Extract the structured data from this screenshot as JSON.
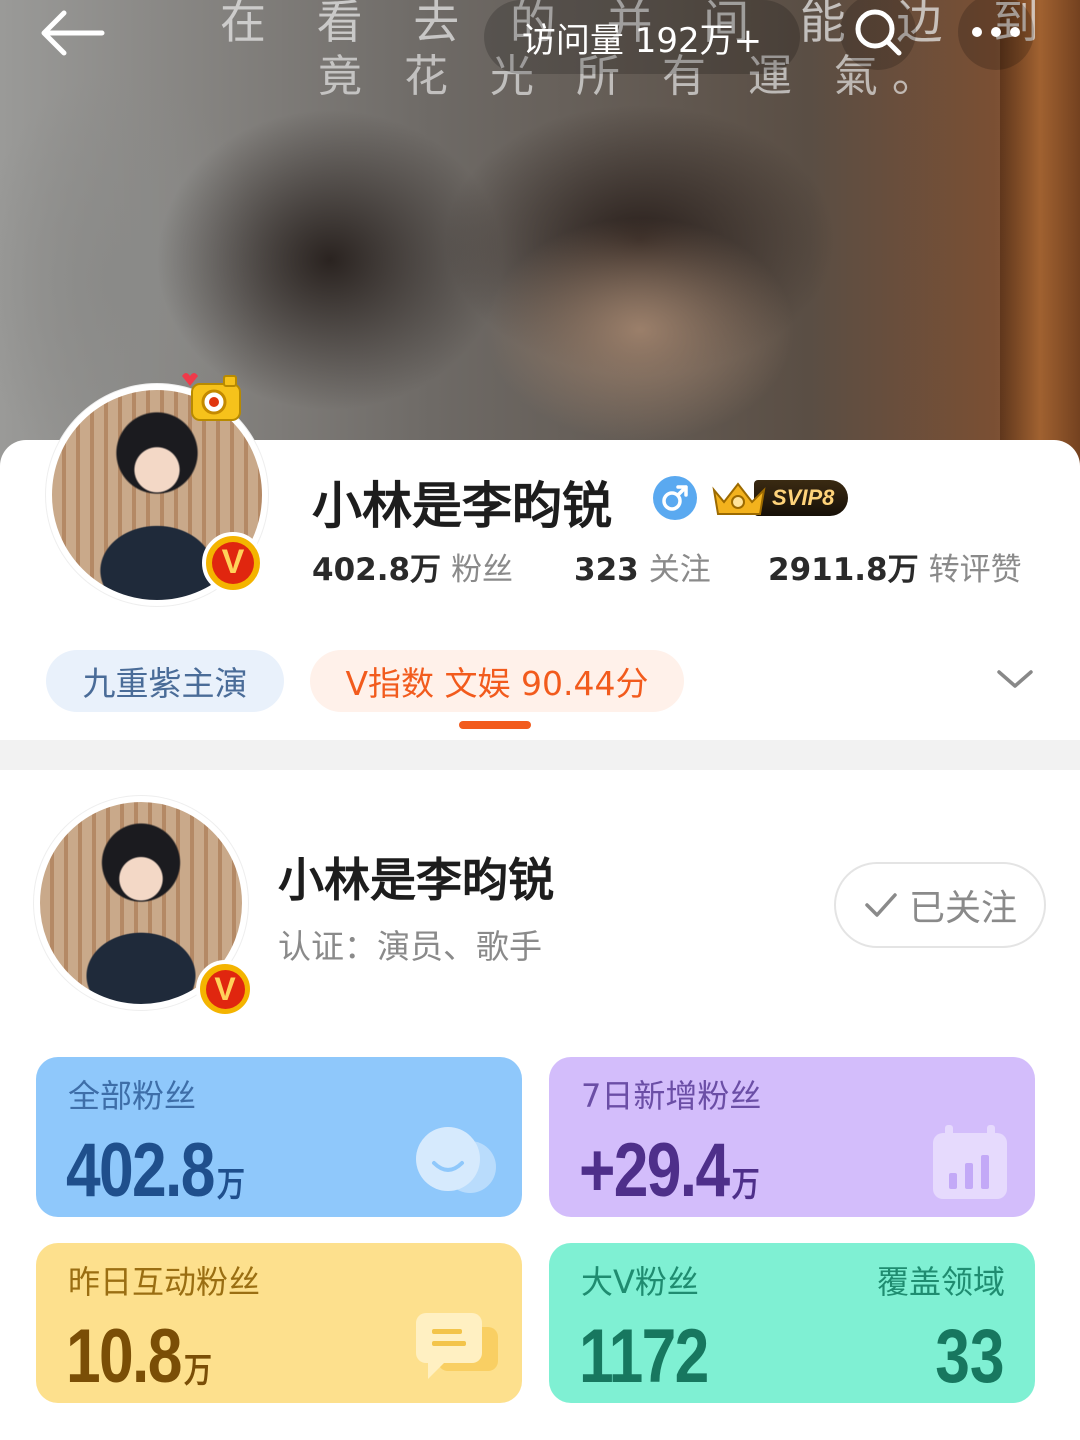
{
  "banner": {
    "caption_line1": "在 看 去 的 并 间 能 边 到 你，",
    "caption_line2": "竟 花 光 所 有 運 氣。",
    "visits": "访问量 192万+"
  },
  "profile": {
    "name": "小林是李昀锐",
    "gender": "male",
    "svip": "SVIP8",
    "stats": [
      {
        "num": "402.8万",
        "label": "粉丝"
      },
      {
        "num": "323",
        "label": "关注"
      },
      {
        "num": "2911.8万",
        "label": "转评赞"
      }
    ],
    "tags": {
      "drama": "九重紫主演",
      "vindex": "V指数 文娱 90.44分"
    }
  },
  "card": {
    "name": "小林是李昀锐",
    "certification": "认证：演员、歌手",
    "follow_label": "已关注"
  },
  "metrics": {
    "all_fans": {
      "title": "全部粉丝",
      "value": "402.8",
      "unit": "万"
    },
    "new_fans": {
      "title": "7日新增粉丝",
      "value": "+29.4",
      "unit": "万"
    },
    "active_fans": {
      "title": "昨日互动粉丝",
      "value": "10.8",
      "unit": "万"
    },
    "bigv_fans": {
      "title": "大V粉丝",
      "value": "1172",
      "title_right": "覆盖领域",
      "value_right": "33"
    }
  },
  "colors": {
    "accent_orange": "#f25b1d",
    "fans_card": "#8fc8fb",
    "new_card": "#d3bdfb",
    "active_card": "#fde08d",
    "bigv_card": "#7ff0d3"
  }
}
